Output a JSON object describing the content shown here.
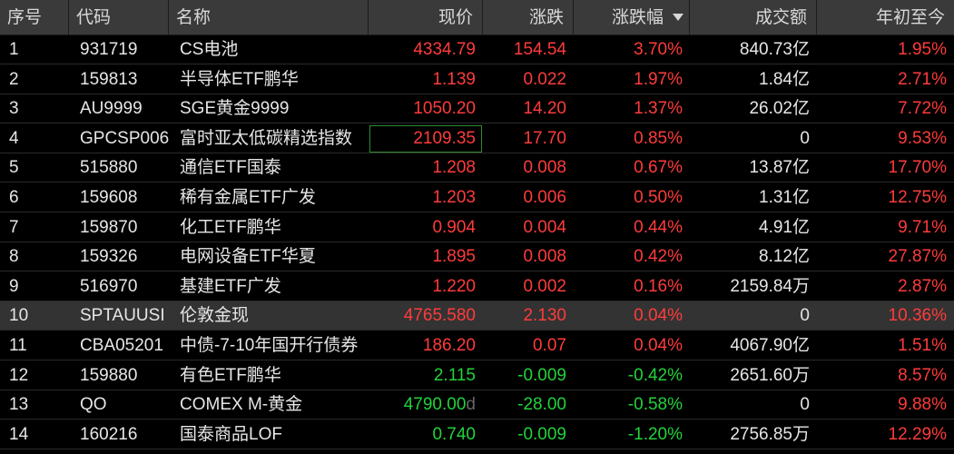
{
  "headers": {
    "idx": "序号",
    "code": "代码",
    "name": "名称",
    "price": "现价",
    "change": "涨跌",
    "pct": "涨跌幅",
    "volume": "成交额",
    "ytd": "年初至今"
  },
  "sort": {
    "column": "涨跌幅",
    "direction": "descending",
    "icon": "sort-desc-triangle-icon"
  },
  "colors": {
    "up": "#ff3b3b",
    "down": "#22d33a",
    "flat": "#e6e6e6",
    "background": "#000000",
    "header": "#3a3a3a",
    "selected_row": "#333333"
  },
  "rows": [
    {
      "idx": "1",
      "code": "931719",
      "name": "CS电池",
      "price": "4334.79",
      "price_suffix": "",
      "change": "154.54",
      "pct": "3.70%",
      "volume": "840.73亿",
      "ytd": "1.95%",
      "dir": "up",
      "ytd_dir": "up"
    },
    {
      "idx": "2",
      "code": "159813",
      "name": "半导体ETF鹏华",
      "price": "1.139",
      "price_suffix": "",
      "change": "0.022",
      "pct": "1.97%",
      "volume": "1.84亿",
      "ytd": "2.71%",
      "dir": "up",
      "ytd_dir": "up"
    },
    {
      "idx": "3",
      "code": "AU9999",
      "name": "SGE黄金9999",
      "price": "1050.20",
      "price_suffix": "",
      "change": "14.20",
      "pct": "1.37%",
      "volume": "26.02亿",
      "ytd": "7.72%",
      "dir": "up",
      "ytd_dir": "up"
    },
    {
      "idx": "4",
      "code": "GPCSP006",
      "name": "富时亚太低碳精选指数",
      "price": "2109.35",
      "price_suffix": "",
      "change": "17.70",
      "pct": "0.85%",
      "volume": "0",
      "ytd": "9.53%",
      "dir": "up",
      "ytd_dir": "up",
      "boxed": true
    },
    {
      "idx": "5",
      "code": "515880",
      "name": "通信ETF国泰",
      "price": "1.208",
      "price_suffix": "",
      "change": "0.008",
      "pct": "0.67%",
      "volume": "13.87亿",
      "ytd": "17.70%",
      "dir": "up",
      "ytd_dir": "up"
    },
    {
      "idx": "6",
      "code": "159608",
      "name": "稀有金属ETF广发",
      "price": "1.203",
      "price_suffix": "",
      "change": "0.006",
      "pct": "0.50%",
      "volume": "1.31亿",
      "ytd": "12.75%",
      "dir": "up",
      "ytd_dir": "up"
    },
    {
      "idx": "7",
      "code": "159870",
      "name": "化工ETF鹏华",
      "price": "0.904",
      "price_suffix": "",
      "change": "0.004",
      "pct": "0.44%",
      "volume": "4.91亿",
      "ytd": "9.71%",
      "dir": "up",
      "ytd_dir": "up"
    },
    {
      "idx": "8",
      "code": "159326",
      "name": "电网设备ETF华夏",
      "price": "1.895",
      "price_suffix": "",
      "change": "0.008",
      "pct": "0.42%",
      "volume": "8.12亿",
      "ytd": "27.87%",
      "dir": "up",
      "ytd_dir": "up"
    },
    {
      "idx": "9",
      "code": "516970",
      "name": "基建ETF广发",
      "price": "1.220",
      "price_suffix": "",
      "change": "0.002",
      "pct": "0.16%",
      "volume": "2159.84万",
      "ytd": "2.87%",
      "dir": "up",
      "ytd_dir": "up"
    },
    {
      "idx": "10",
      "code": "SPTAUUSI",
      "name": "伦敦金现",
      "price": "4765.580",
      "price_suffix": "",
      "change": "2.130",
      "pct": "0.04%",
      "volume": "0",
      "ytd": "10.36%",
      "dir": "up",
      "ytd_dir": "up",
      "selected": true
    },
    {
      "idx": "11",
      "code": "CBA05201",
      "name": "中债-7-10年国开行债券",
      "price": "186.20",
      "price_suffix": "",
      "change": "0.07",
      "pct": "0.04%",
      "volume": "4067.90亿",
      "ytd": "1.51%",
      "dir": "up",
      "ytd_dir": "up"
    },
    {
      "idx": "12",
      "code": "159880",
      "name": "有色ETF鹏华",
      "price": "2.115",
      "price_suffix": "",
      "change": "-0.009",
      "pct": "-0.42%",
      "volume": "2651.60万",
      "ytd": "8.57%",
      "dir": "down",
      "ytd_dir": "up"
    },
    {
      "idx": "13",
      "code": "QO",
      "name": "COMEX M-黄金",
      "price": "4790.00",
      "price_suffix": "d",
      "change": "-28.00",
      "pct": "-0.58%",
      "volume": "0",
      "ytd": "9.88%",
      "dir": "down",
      "ytd_dir": "up"
    },
    {
      "idx": "14",
      "code": "160216",
      "name": "国泰商品LOF",
      "price": "0.740",
      "price_suffix": "",
      "change": "-0.009",
      "pct": "-1.20%",
      "volume": "2756.85万",
      "ytd": "12.29%",
      "dir": "down",
      "ytd_dir": "up"
    }
  ]
}
